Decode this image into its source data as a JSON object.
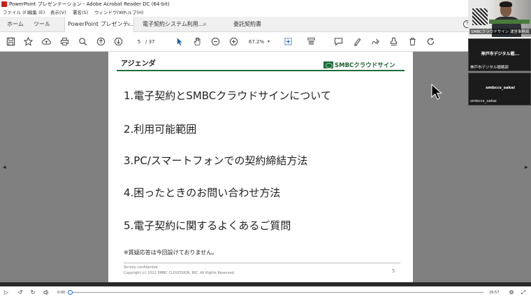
{
  "window": {
    "title": "PowerPoint プレゼンテーション - Adobe Acrobat Reader DC (64-bit)"
  },
  "menu": [
    "ファイル (F)",
    "編集 (E)",
    "表示(V)",
    "署名(S)",
    "ウィンドウ(W)",
    "ヘルプ(H)"
  ],
  "tabs": {
    "home": "ホーム",
    "tools": "ツール",
    "documents": [
      {
        "label": "PowerPoint プレゼンテ...",
        "close": "×"
      },
      {
        "label": "電子契約システム利用...",
        "close": "×"
      },
      {
        "label": "委託契約書",
        "close": ""
      }
    ]
  },
  "help": "?",
  "toolbar": {
    "page_current": "5",
    "page_total": "/ 37",
    "zoom": "67.2%",
    "zoom_caret": "▾",
    "icons": [
      "save-icon",
      "bookmark-star-icon",
      "upload-cloud-icon",
      "print-icon",
      "search-icon",
      "page-up-icon",
      "page-down-icon",
      "pointer-icon",
      "hand-icon",
      "zoom-out-icon",
      "zoom-in-icon",
      "fit-page-icon",
      "scroll-mode-icon",
      "comment-icon",
      "highlight-icon",
      "sign-icon",
      "stamp-icon",
      "delete-icon",
      "rotate-icon"
    ]
  },
  "slide": {
    "title": "アジェンダ",
    "logo_text": "SMBCクラウドサイン",
    "items": [
      "1.電子契約とSMBCクラウドサインについて",
      "2.利用可能範囲",
      "3.PC/スマートフォンでの契約締結方法",
      "4.困ったときのお問い合わせ方法",
      "5.電子契約に関するよくあるご質問"
    ],
    "note": "※質疑応答は今回設けておりません。",
    "footer_line1": "Strictly confidential",
    "footer_line2": "Copyright (c) 2022 SMBC CLOUDSIGN, INC. All Rights Reserved",
    "page_number": "5"
  },
  "participants": [
    {
      "label": "SMBCクラウドサイン 運営事務局"
    },
    {
      "center": "神戸市デジタル戦...",
      "label": "神戸市デジタル戦略部"
    },
    {
      "center": "smbccs_sakai",
      "label": "smbccs_sakai"
    }
  ],
  "player": {
    "current_time": "0:00",
    "end_time": "29:57",
    "progress": 0
  },
  "colors": {
    "brand_green": "#1e6b3a",
    "doc_background": "#808080",
    "acrobat_red": "#c8211b"
  }
}
